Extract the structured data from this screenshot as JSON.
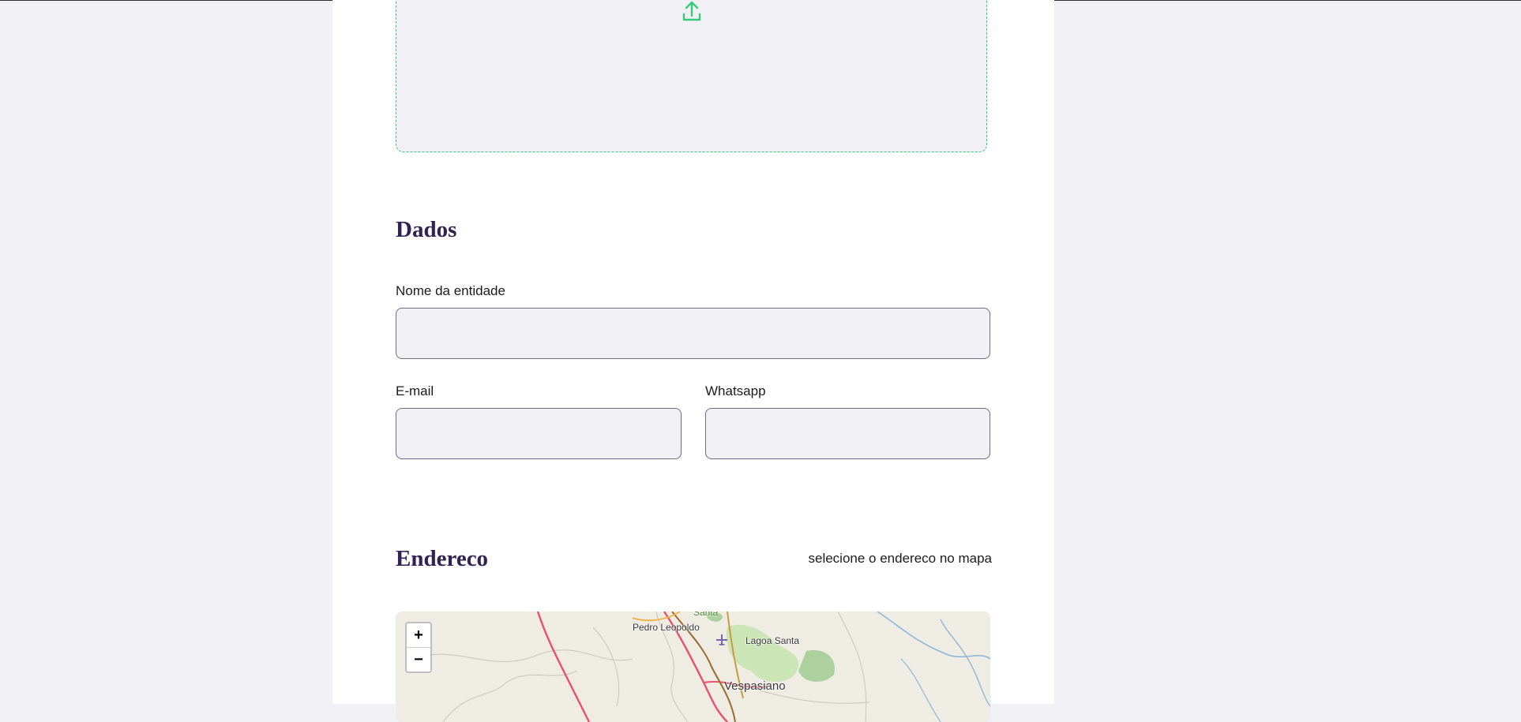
{
  "dados": {
    "title": "Dados",
    "name_label": "Nome da entidade",
    "email_label": "E-mail",
    "whatsapp_label": "Whatsapp"
  },
  "endereco": {
    "title": "Endereco",
    "hint": "selecione o endereco no mapa"
  },
  "map": {
    "zoom_in": "+",
    "zoom_out": "−",
    "places": {
      "pedro_leopoldo": "Pedro Leopoldo",
      "lagoa_santa": "Lagoa Santa",
      "vespasiano": "Vespasiano",
      "top_partial": "Santa"
    }
  },
  "colors": {
    "accent": "#34cb79",
    "title": "#322153",
    "field_bg": "#f0f0f5"
  }
}
